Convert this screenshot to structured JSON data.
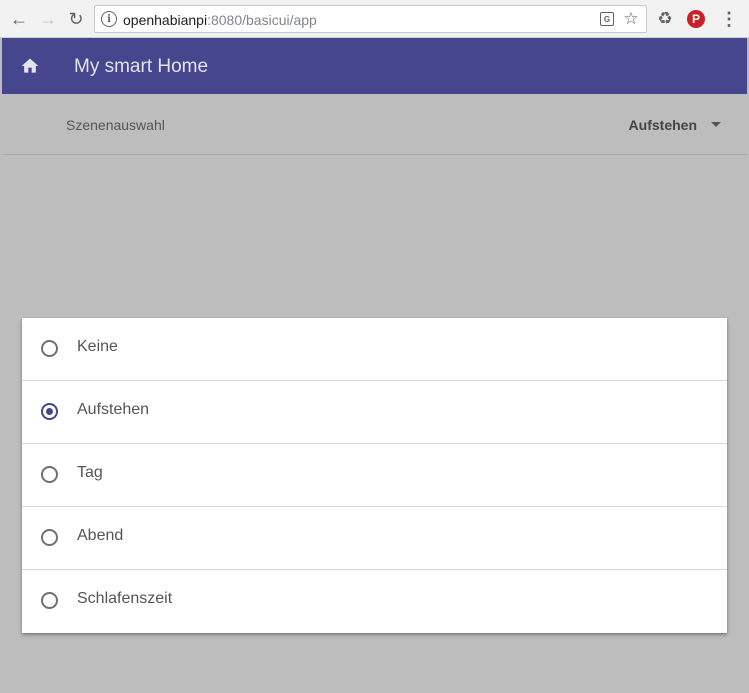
{
  "browser": {
    "url_host": "openhabianpi",
    "url_rest": ":8080/basicui/app"
  },
  "app": {
    "title": "My smart Home",
    "accent_color": "#45468e"
  },
  "selection": {
    "label": "Szenenauswahl",
    "value": "Aufstehen"
  },
  "dialog": {
    "options": [
      {
        "label": "Keine",
        "checked": false
      },
      {
        "label": "Aufstehen",
        "checked": true
      },
      {
        "label": "Tag",
        "checked": false
      },
      {
        "label": "Abend",
        "checked": false
      },
      {
        "label": "Schlafenszeit",
        "checked": false
      }
    ]
  }
}
